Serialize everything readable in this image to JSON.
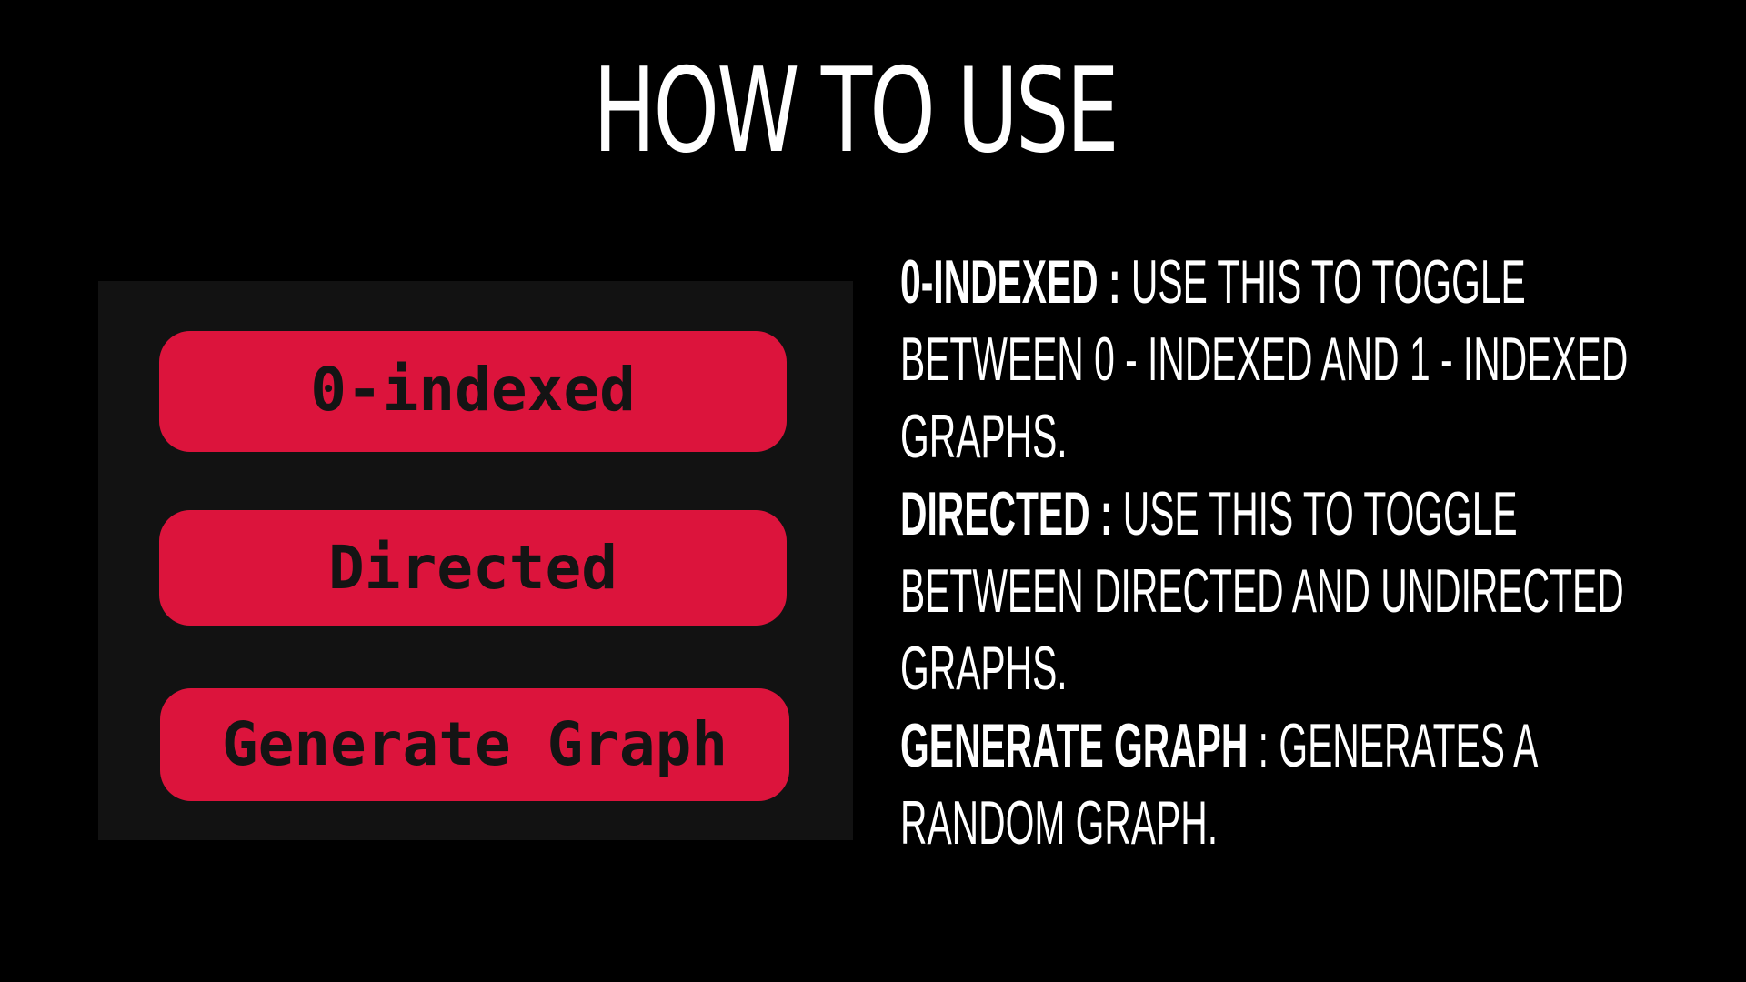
{
  "title": "HOW TO USE",
  "colors": {
    "background": "#000000",
    "panel": "#121212",
    "button": "#dc143c",
    "button_text": "#141414",
    "text": "#ffffff"
  },
  "buttons": [
    {
      "label": "0-indexed"
    },
    {
      "label": "Directed"
    },
    {
      "label": "Generate Graph"
    }
  ],
  "descriptions": [
    {
      "term": "0-INDEXED",
      "sep": " : ",
      "lines": [
        "USE THIS TO TOGGLE",
        "BETWEEN 0 - INDEXED AND 1 - INDEXED",
        "GRAPHS."
      ]
    },
    {
      "term": "DIRECTED",
      "sep": " : ",
      "lines": [
        "USE THIS TO TOGGLE",
        "BETWEEN DIRECTED AND UNDIRECTED",
        "GRAPHS."
      ]
    },
    {
      "term": "GENERATE GRAPH",
      "sep": " : ",
      "lines": [
        "GENERATES A",
        "RANDOM GRAPH."
      ]
    }
  ]
}
